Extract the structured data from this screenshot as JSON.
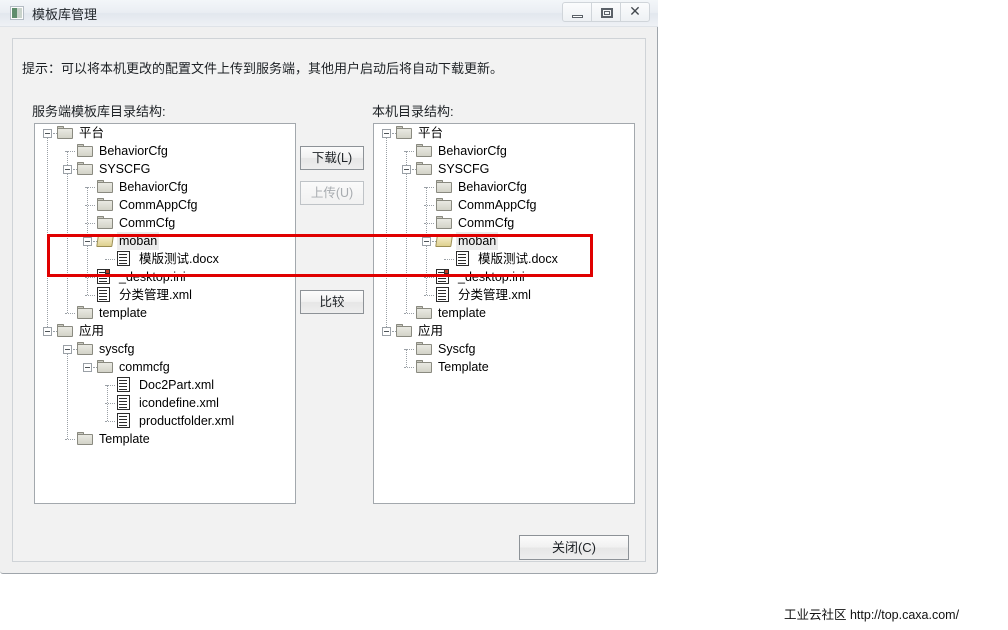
{
  "window": {
    "title": "模板库管理",
    "icon": "app-icon",
    "buttons": {
      "minimize": "minimize-icon",
      "maximize": "maximize-icon",
      "close": "✕"
    }
  },
  "hint": "提示：可以将本机更改的配置文件上传到服务端，其他用户启动后将自动下载更新。",
  "labels": {
    "server_tree": "服务端模板库目录结构:",
    "local_tree": "本机目录结构:"
  },
  "buttons": {
    "download": "下载(L)",
    "upload": "上传(U)",
    "compare": "比较",
    "close": "关闭(C)"
  },
  "server_tree": [
    {
      "label": "平台",
      "depth": 0,
      "icon": "folder",
      "expander": "collapse",
      "selected": false
    },
    {
      "label": "BehaviorCfg",
      "depth": 1,
      "icon": "folder",
      "expander": "none",
      "selected": false
    },
    {
      "label": "SYSCFG",
      "depth": 1,
      "icon": "folder",
      "expander": "collapse",
      "selected": false
    },
    {
      "label": "BehaviorCfg",
      "depth": 2,
      "icon": "folder",
      "expander": "none",
      "selected": false
    },
    {
      "label": "CommAppCfg",
      "depth": 2,
      "icon": "folder",
      "expander": "none",
      "selected": false
    },
    {
      "label": "CommCfg",
      "depth": 2,
      "icon": "folder",
      "expander": "none",
      "selected": false
    },
    {
      "label": "moban",
      "depth": 2,
      "icon": "folder-open",
      "expander": "collapse",
      "selected": true
    },
    {
      "label": "模版测试.docx",
      "depth": 3,
      "icon": "file",
      "expander": "none",
      "selected": false
    },
    {
      "label": "_desktop.ini",
      "depth": 2,
      "icon": "file-ini",
      "expander": "none",
      "selected": false
    },
    {
      "label": "分类管理.xml",
      "depth": 2,
      "icon": "file",
      "expander": "none",
      "selected": false
    },
    {
      "label": "template",
      "depth": 1,
      "icon": "folder",
      "expander": "none",
      "selected": false
    },
    {
      "label": "应用",
      "depth": 0,
      "icon": "folder",
      "expander": "collapse",
      "selected": false
    },
    {
      "label": "syscfg",
      "depth": 1,
      "icon": "folder",
      "expander": "collapse",
      "selected": false
    },
    {
      "label": "commcfg",
      "depth": 2,
      "icon": "folder",
      "expander": "collapse",
      "selected": false
    },
    {
      "label": "Doc2Part.xml",
      "depth": 3,
      "icon": "file",
      "expander": "none",
      "selected": false
    },
    {
      "label": "icondefine.xml",
      "depth": 3,
      "icon": "file",
      "expander": "none",
      "selected": false
    },
    {
      "label": "productfolder.xml",
      "depth": 3,
      "icon": "file",
      "expander": "none",
      "selected": false
    },
    {
      "label": "Template",
      "depth": 1,
      "icon": "folder",
      "expander": "none",
      "selected": false
    }
  ],
  "local_tree": [
    {
      "label": "平台",
      "depth": 0,
      "icon": "folder",
      "expander": "collapse",
      "selected": false
    },
    {
      "label": "BehaviorCfg",
      "depth": 1,
      "icon": "folder",
      "expander": "none",
      "selected": false
    },
    {
      "label": "SYSCFG",
      "depth": 1,
      "icon": "folder",
      "expander": "collapse",
      "selected": false
    },
    {
      "label": "BehaviorCfg",
      "depth": 2,
      "icon": "folder",
      "expander": "none",
      "selected": false
    },
    {
      "label": "CommAppCfg",
      "depth": 2,
      "icon": "folder",
      "expander": "none",
      "selected": false
    },
    {
      "label": "CommCfg",
      "depth": 2,
      "icon": "folder",
      "expander": "none",
      "selected": false
    },
    {
      "label": "moban",
      "depth": 2,
      "icon": "folder-open",
      "expander": "collapse",
      "selected": true
    },
    {
      "label": "模版测试.docx",
      "depth": 3,
      "icon": "file",
      "expander": "none",
      "selected": false
    },
    {
      "label": "_desktop.ini",
      "depth": 2,
      "icon": "file-ini",
      "expander": "none",
      "selected": false
    },
    {
      "label": "分类管理.xml",
      "depth": 2,
      "icon": "file",
      "expander": "none",
      "selected": false
    },
    {
      "label": "template",
      "depth": 1,
      "icon": "folder",
      "expander": "none",
      "selected": false
    },
    {
      "label": "应用",
      "depth": 0,
      "icon": "folder",
      "expander": "collapse",
      "selected": false
    },
    {
      "label": "Syscfg",
      "depth": 1,
      "icon": "folder",
      "expander": "none",
      "selected": false
    },
    {
      "label": "Template",
      "depth": 1,
      "icon": "folder",
      "expander": "none",
      "selected": false
    }
  ],
  "annotation": {
    "color": "#e00000",
    "shape": "rectangle"
  },
  "watermark": "工业云社区 http://top.caxa.com/"
}
